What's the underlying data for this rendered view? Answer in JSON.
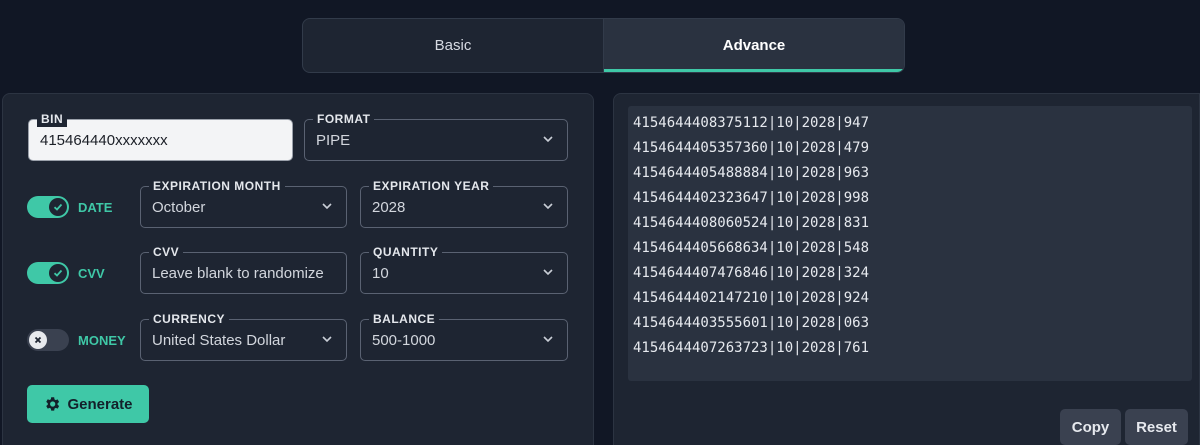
{
  "tabs": [
    {
      "label": "Basic",
      "active": false
    },
    {
      "label": "Advance",
      "active": true
    }
  ],
  "form": {
    "bin": {
      "label": "BIN",
      "value": "415464440xxxxxxx"
    },
    "format": {
      "label": "FORMAT",
      "value": "PIPE"
    },
    "date_toggle": {
      "label": "DATE",
      "on": true
    },
    "expiration_month": {
      "label": "EXPIRATION MONTH",
      "value": "October"
    },
    "expiration_year": {
      "label": "EXPIRATION YEAR",
      "value": "2028"
    },
    "cvv_toggle": {
      "label": "CVV",
      "on": true
    },
    "cvv": {
      "label": "CVV",
      "value": "Leave blank to randomize"
    },
    "quantity": {
      "label": "QUANTITY",
      "value": "10"
    },
    "money_toggle": {
      "label": "MONEY",
      "on": false
    },
    "currency": {
      "label": "CURRENCY",
      "value": "United States Dollar"
    },
    "balance": {
      "label": "BALANCE",
      "value": "500-1000"
    },
    "generate_label": "Generate"
  },
  "output": {
    "lines": [
      "4154644408375112|10|2028|947",
      "4154644405357360|10|2028|479",
      "4154644405488884|10|2028|963",
      "4154644402323647|10|2028|998",
      "4154644408060524|10|2028|831",
      "4154644405668634|10|2028|548",
      "4154644407476846|10|2028|324",
      "4154644402147210|10|2028|924",
      "4154644403555601|10|2028|063",
      "4154644407263723|10|2028|761"
    ],
    "copy_label": "Copy",
    "reset_label": "Reset"
  },
  "colors": {
    "accent": "#3fc8a7",
    "background": "#111725",
    "panel": "#1e2532"
  },
  "icons": {
    "chevron": "chevron-down-icon",
    "check": "check-icon",
    "x": "x-icon",
    "gear": "gear-icon"
  }
}
